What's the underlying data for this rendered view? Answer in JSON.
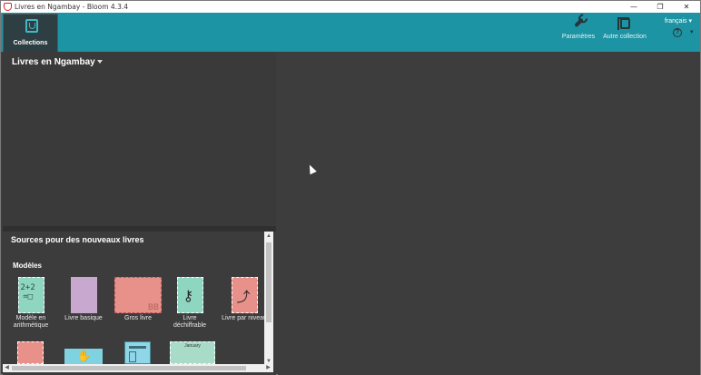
{
  "window": {
    "title": "Livres en Ngambay - Bloom 4.3.4",
    "minimize": "—",
    "restore": "❐",
    "close": "✕"
  },
  "toolbar": {
    "collections_tab": "Collections",
    "settings": "Paramètres",
    "other_collection": "Autre collection",
    "language": "français ▾",
    "help_icon": "?",
    "help_caret": "▾"
  },
  "collection": {
    "title": "Livres en Ngambay"
  },
  "sources": {
    "title": "Sources pour des nouveaux livres",
    "section": "Modèles",
    "books": [
      {
        "label": "Modèle en arithmétique",
        "color": "#8fd6c0",
        "icon": "math-icon",
        "glyph": "2+2\n=□"
      },
      {
        "label": "Livre basique",
        "color": "#c9a8cf",
        "icon": "blank-book-icon",
        "glyph": ""
      },
      {
        "label": "Gros livre",
        "color": "#e8918a",
        "icon": "big-book-icon",
        "glyph": "BB"
      },
      {
        "label": "Livre déchiffrable",
        "color": "#8fd6c0",
        "icon": "keys-icon",
        "glyph": "⚷"
      },
      {
        "label": "Livre par niveau",
        "color": "#e8918a",
        "icon": "stairs-icon",
        "glyph": "⤴"
      }
    ],
    "books_row2": [
      {
        "color": "#e8918a",
        "icon": "picture-dictionary-icon"
      },
      {
        "color": "#7fd2e0",
        "icon": "sign-language-icon"
      },
      {
        "color": "#8fd6e8",
        "icon": "layout-icon"
      },
      {
        "color": "#a8dcc8",
        "icon": "calendar-icon",
        "glyph": "January"
      }
    ]
  },
  "scroll": {
    "up": "▲",
    "down": "▼",
    "left": "◀",
    "right": "▶"
  }
}
